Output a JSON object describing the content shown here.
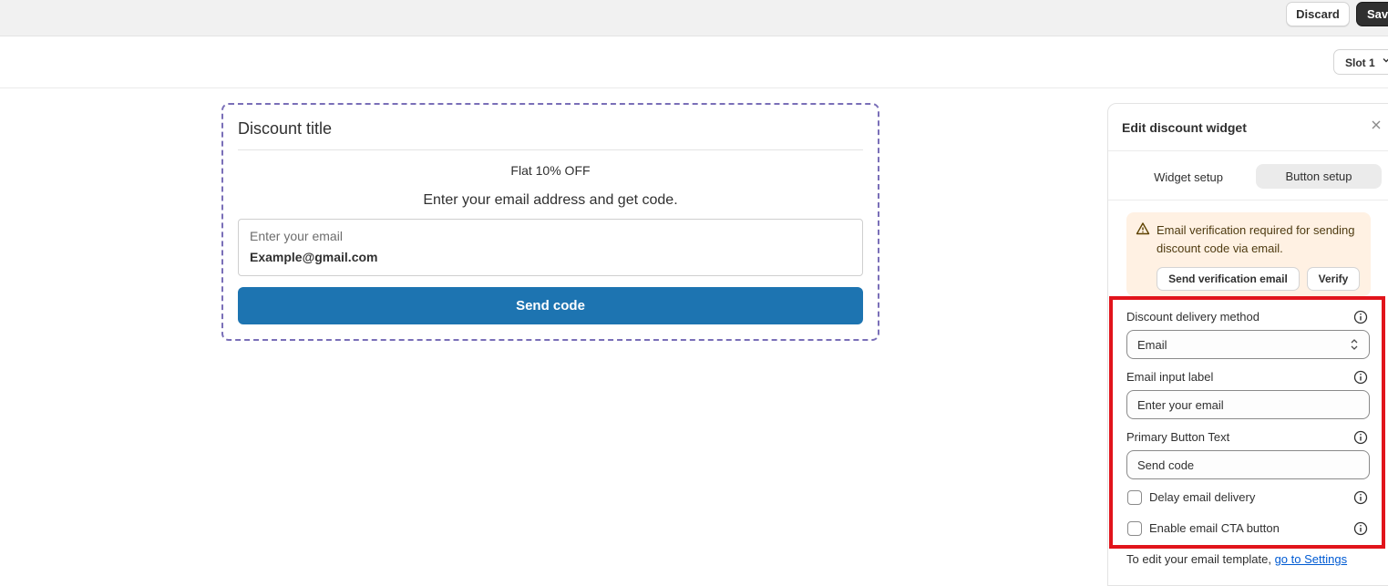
{
  "topbar": {
    "discard_label": "Discard",
    "save_label": "Save"
  },
  "subbar": {
    "slot_value": "Slot 1"
  },
  "widget": {
    "title": "Discount title",
    "offer": "Flat 10% OFF",
    "description": "Enter your email address and get code.",
    "input_label": "Enter your email",
    "input_value": "Example@gmail.com",
    "button_label": "Send code",
    "button_color": "#1d74b1",
    "border_color": "#7a6fb8"
  },
  "panel": {
    "title": "Edit discount widget",
    "tabs": [
      {
        "label": "Widget setup",
        "active": false
      },
      {
        "label": "Button setup",
        "active": true
      }
    ],
    "alert": {
      "text": "Email verification required for sending discount code via email.",
      "send_button": "Send verification email",
      "verify_button": "Verify",
      "icon": "warning-icon"
    },
    "fields": {
      "delivery_method_label": "Discount delivery method",
      "delivery_method_value": "Email",
      "email_input_label": "Email input label",
      "email_input_value": "Enter your email",
      "primary_button_label": "Primary Button Text",
      "primary_button_value": "Send code",
      "delay_label": "Delay email delivery",
      "delay_checked": false,
      "cta_label": "Enable email CTA button",
      "cta_checked": false
    },
    "footer_text": "To edit your email template, ",
    "footer_link": "go to Settings"
  },
  "colors": {
    "highlight": "#e1141b",
    "link": "#005bd3",
    "alert_bg": "#fff1e3"
  }
}
